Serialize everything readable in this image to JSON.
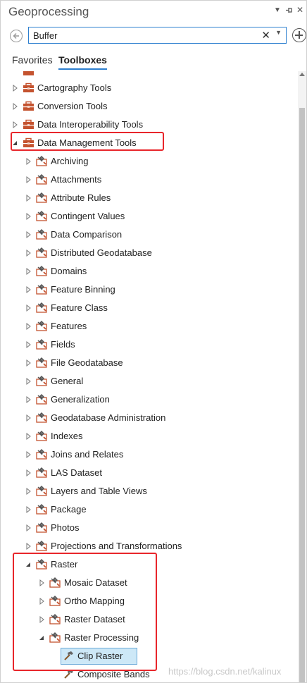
{
  "window": {
    "title": "Geoprocessing",
    "controls": [
      "chevron-down-icon",
      "pin-icon",
      "close-icon"
    ]
  },
  "search": {
    "value": "Buffer",
    "clear_glyph": "✕",
    "dropdown_glyph": "▼"
  },
  "tabs": [
    {
      "label": "Favorites",
      "active": false
    },
    {
      "label": "Toolboxes",
      "active": true
    }
  ],
  "tree": [
    {
      "label": "Cartography Tools",
      "level": 0,
      "expanded": false,
      "icon": "toolbox-icon"
    },
    {
      "label": "Conversion Tools",
      "level": 0,
      "expanded": false,
      "icon": "toolbox-icon"
    },
    {
      "label": "Data Interoperability Tools",
      "level": 0,
      "expanded": false,
      "icon": "toolbox-icon"
    },
    {
      "label": "Data Management Tools",
      "level": 0,
      "expanded": true,
      "icon": "toolbox-icon"
    },
    {
      "label": "Archiving",
      "level": 1,
      "expanded": false,
      "icon": "toolset-icon"
    },
    {
      "label": "Attachments",
      "level": 1,
      "expanded": false,
      "icon": "toolset-icon"
    },
    {
      "label": "Attribute Rules",
      "level": 1,
      "expanded": false,
      "icon": "toolset-icon"
    },
    {
      "label": "Contingent Values",
      "level": 1,
      "expanded": false,
      "icon": "toolset-icon"
    },
    {
      "label": "Data Comparison",
      "level": 1,
      "expanded": false,
      "icon": "toolset-icon"
    },
    {
      "label": "Distributed Geodatabase",
      "level": 1,
      "expanded": false,
      "icon": "toolset-icon"
    },
    {
      "label": "Domains",
      "level": 1,
      "expanded": false,
      "icon": "toolset-icon"
    },
    {
      "label": "Feature Binning",
      "level": 1,
      "expanded": false,
      "icon": "toolset-icon"
    },
    {
      "label": "Feature Class",
      "level": 1,
      "expanded": false,
      "icon": "toolset-icon"
    },
    {
      "label": "Features",
      "level": 1,
      "expanded": false,
      "icon": "toolset-icon"
    },
    {
      "label": "Fields",
      "level": 1,
      "expanded": false,
      "icon": "toolset-icon"
    },
    {
      "label": "File Geodatabase",
      "level": 1,
      "expanded": false,
      "icon": "toolset-icon"
    },
    {
      "label": "General",
      "level": 1,
      "expanded": false,
      "icon": "toolset-icon"
    },
    {
      "label": "Generalization",
      "level": 1,
      "expanded": false,
      "icon": "toolset-icon"
    },
    {
      "label": "Geodatabase Administration",
      "level": 1,
      "expanded": false,
      "icon": "toolset-icon"
    },
    {
      "label": "Indexes",
      "level": 1,
      "expanded": false,
      "icon": "toolset-icon"
    },
    {
      "label": "Joins and Relates",
      "level": 1,
      "expanded": false,
      "icon": "toolset-icon"
    },
    {
      "label": "LAS Dataset",
      "level": 1,
      "expanded": false,
      "icon": "toolset-icon"
    },
    {
      "label": "Layers and Table Views",
      "level": 1,
      "expanded": false,
      "icon": "toolset-icon"
    },
    {
      "label": "Package",
      "level": 1,
      "expanded": false,
      "icon": "toolset-icon"
    },
    {
      "label": "Photos",
      "level": 1,
      "expanded": false,
      "icon": "toolset-icon"
    },
    {
      "label": "Projections and Transformations",
      "level": 1,
      "expanded": false,
      "icon": "toolset-icon"
    },
    {
      "label": "Raster",
      "level": 1,
      "expanded": true,
      "icon": "toolset-icon"
    },
    {
      "label": "Mosaic Dataset",
      "level": 2,
      "expanded": false,
      "icon": "toolset-icon"
    },
    {
      "label": "Ortho Mapping",
      "level": 2,
      "expanded": false,
      "icon": "toolset-icon"
    },
    {
      "label": "Raster Dataset",
      "level": 2,
      "expanded": false,
      "icon": "toolset-icon"
    },
    {
      "label": "Raster Processing",
      "level": 2,
      "expanded": true,
      "icon": "toolset-icon"
    },
    {
      "label": "Clip Raster",
      "level": 3,
      "tool": true,
      "selected": true,
      "icon": "hammer-icon"
    },
    {
      "label": "Composite Bands",
      "level": 3,
      "tool": true,
      "selected": false,
      "icon": "hammer-icon"
    }
  ],
  "colors": {
    "accent": "#2d7fcf",
    "highlight_box": "#e8262b",
    "toolbox": "#c4532f",
    "selection": "#cde8f7"
  },
  "watermark": "https://blog.csdn.net/kalinux"
}
